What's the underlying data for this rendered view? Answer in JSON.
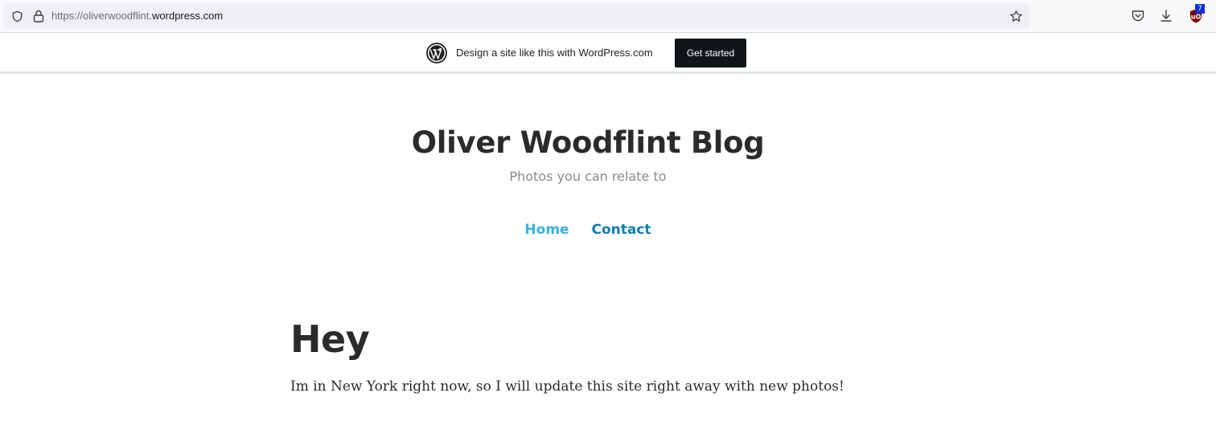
{
  "browser": {
    "url_prefix": "https://oliverwoodflint.",
    "url_domain": "wordpress.com",
    "extension_badge": "7",
    "icons": [
      "shield-icon",
      "lock-icon",
      "bookmark-star-icon",
      "pocket-icon",
      "download-icon",
      "ublock-icon"
    ]
  },
  "wp_banner": {
    "text": "Design a site like this with WordPress.com",
    "button_label": "Get started"
  },
  "site": {
    "title": "Oliver Woodflint Blog",
    "tagline": "Photos you can relate to"
  },
  "nav": {
    "items": [
      {
        "label": "Home"
      },
      {
        "label": "Contact"
      }
    ]
  },
  "post": {
    "title": "Hey",
    "body": "Im in New York right now, so I will update this site right away with new photos!"
  },
  "colors": {
    "nav_home": "#37b2e3",
    "nav_contact": "#0c7fb1",
    "heading": "#2b2b2b",
    "tagline": "#8a8a8a",
    "wp_button": "#101517"
  }
}
